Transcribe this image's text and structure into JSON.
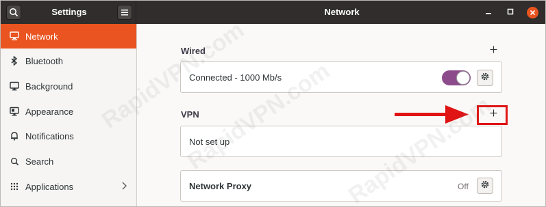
{
  "header": {
    "sidebar_title": "Settings",
    "main_title": "Network",
    "search_icon": "search-icon",
    "menu_icon": "hamburger-menu-icon",
    "minimize_icon": "minimize-icon",
    "maximize_icon": "maximize-icon",
    "close_icon": "close-icon"
  },
  "sidebar": {
    "items": [
      {
        "label": "Network",
        "icon": "network-icon",
        "active": true
      },
      {
        "label": "Bluetooth",
        "icon": "bluetooth-icon",
        "active": false
      },
      {
        "label": "Background",
        "icon": "monitor-icon",
        "active": false
      },
      {
        "label": "Appearance",
        "icon": "appearance-icon",
        "active": false
      },
      {
        "label": "Notifications",
        "icon": "bell-icon",
        "active": false
      },
      {
        "label": "Search",
        "icon": "search-icon",
        "active": false
      },
      {
        "label": "Applications",
        "icon": "grid-icon",
        "active": false,
        "has_chevron": true
      }
    ]
  },
  "main": {
    "wired": {
      "label": "Wired",
      "status": "Connected - 1000 Mb/s",
      "toggle_on": true
    },
    "vpn": {
      "label": "VPN",
      "status": "Not set up"
    },
    "proxy": {
      "label": "Network Proxy",
      "status": "Off"
    }
  },
  "watermark": "RapidVPN.com",
  "colors": {
    "accent": "#e95420",
    "header_bg": "#302d2c",
    "toggle_on": "#8c4c8c",
    "annotation": "#e01414"
  }
}
